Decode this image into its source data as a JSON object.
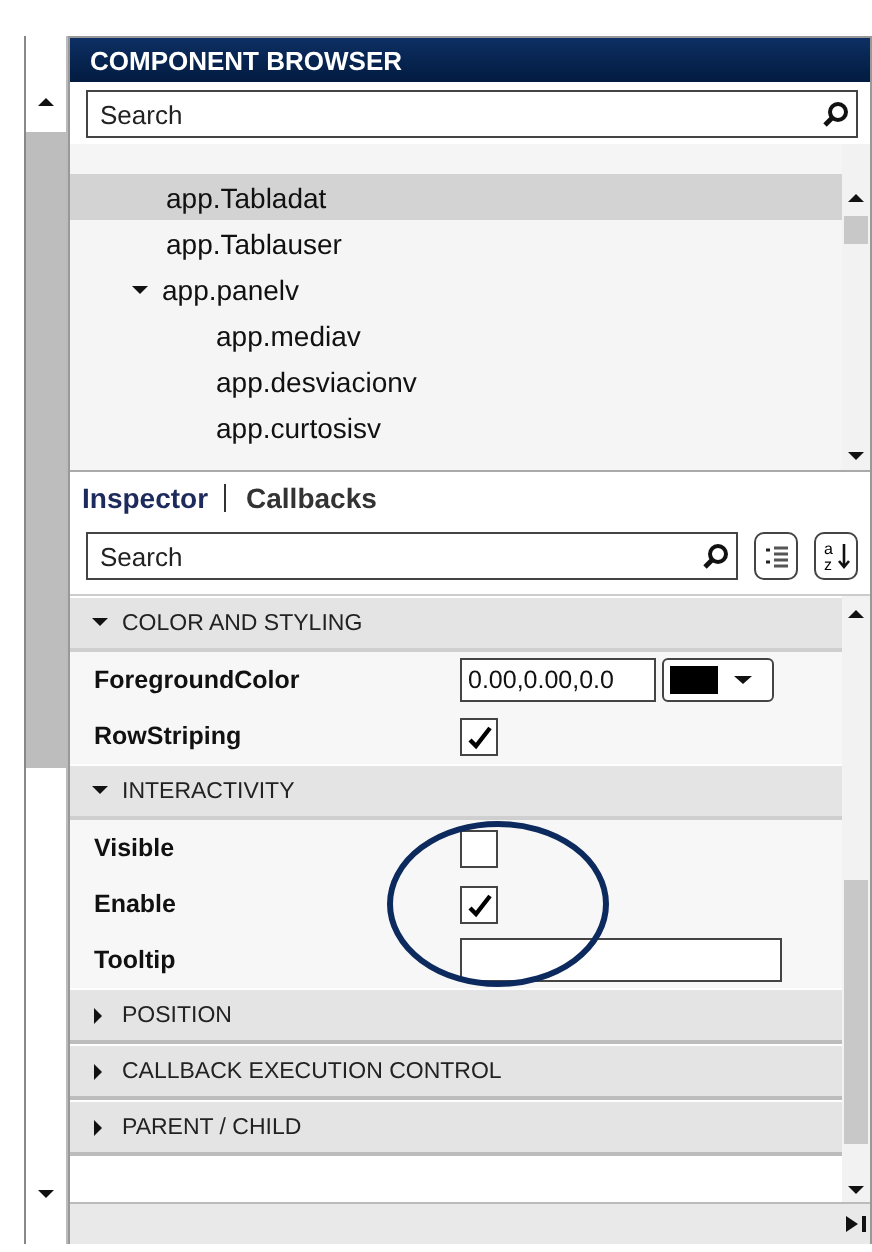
{
  "browser": {
    "title": "COMPONENT BROWSER",
    "search": {
      "placeholder": "Search"
    }
  },
  "tree": [
    {
      "label": "app.Tabladat",
      "selected": true
    },
    {
      "label": "app.Tablauser",
      "selected": false
    },
    {
      "label": "app.panelv",
      "selected": false,
      "expanded": true,
      "children": [
        {
          "label": "app.mediav",
          "selected": false
        },
        {
          "label": "app.desviacionv",
          "selected": false
        },
        {
          "label": "app.curtosisv",
          "selected": false
        }
      ]
    }
  ],
  "tabs": [
    {
      "label": "Inspector",
      "selected": true
    },
    {
      "label": "Callbacks",
      "selected": false
    }
  ],
  "inspector_search": {
    "placeholder": "Search"
  },
  "sort_button": {
    "letters": [
      "a",
      "z"
    ]
  },
  "sections": [
    {
      "title": "COLOR AND STYLING",
      "expanded": true,
      "properties": [
        {
          "kind": "color",
          "label": "ForegroundColor",
          "value": "0.00,0.00,0.0",
          "color": "#000000"
        },
        {
          "kind": "checkbox",
          "label": "RowStriping",
          "checked": true
        }
      ]
    },
    {
      "title": "INTERACTIVITY",
      "expanded": true,
      "properties": [
        {
          "kind": "checkbox",
          "label": "Visible",
          "checked": false
        },
        {
          "kind": "checkbox",
          "label": "Enable",
          "checked": true
        },
        {
          "kind": "text",
          "label": "Tooltip"
        }
      ]
    },
    {
      "title": "POSITION",
      "expanded": false
    },
    {
      "title": "CALLBACK EXECUTION CONTROL",
      "expanded": false
    },
    {
      "title": "PARENT / CHILD",
      "expanded": false
    }
  ]
}
